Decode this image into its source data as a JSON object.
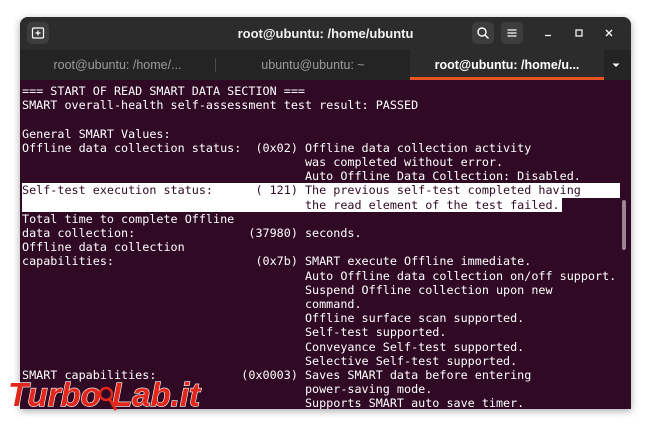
{
  "window": {
    "title": "root@ubuntu: /home/ubuntu"
  },
  "tabs": [
    {
      "label": "root@ubuntu: /home/...",
      "active": false
    },
    {
      "label": "ubuntu@ubuntu: ~",
      "active": false
    },
    {
      "label": "root@ubuntu: /home/u...",
      "active": true
    }
  ],
  "terminal": {
    "lines": [
      "=== START OF READ SMART DATA SECTION ===",
      "SMART overall-health self-assessment test result: PASSED",
      "",
      "General SMART Values:",
      "Offline data collection status:  (0x02) Offline data collection activity",
      "                                        was completed without error.",
      "                                        Auto Offline Data Collection: Disabled.",
      "Self-test execution status:      ( 121) The previous self-test completed having",
      "                                        the read element of the test failed.",
      "Total time to complete Offline",
      "data collection:                (37980) seconds.",
      "Offline data collection",
      "capabilities:                    (0x7b) SMART execute Offline immediate.",
      "                                        Auto Offline data collection on/off support.",
      "                                        Suspend Offline collection upon new",
      "                                        command.",
      "                                        Offline surface scan supported.",
      "                                        Self-test supported.",
      "                                        Conveyance Self-test supported.",
      "                                        Selective Self-test supported.",
      "SMART capabilities:            (0x0003) Saves SMART data before entering",
      "                                        power-saving mode.",
      "                                        Supports SMART auto save timer."
    ]
  },
  "watermark": {
    "text_left": "Turbo",
    "text_right": "Lab.it"
  },
  "colors": {
    "terminal_bg": "#300a24",
    "accent": "#e95420",
    "watermark_red": "#e1261c"
  }
}
